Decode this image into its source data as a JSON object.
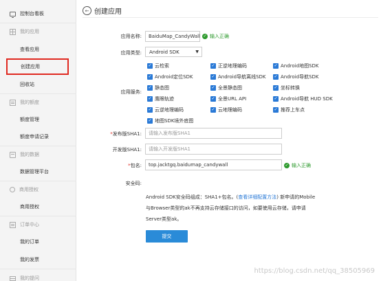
{
  "sidebar": {
    "dashboard": "控制台看板",
    "groups": {
      "apps": "我的应用",
      "quota": "我的额度",
      "data": "我的数据",
      "commercial": "商用授权",
      "orders": "订单中心",
      "tickets": "我的提问"
    },
    "items": {
      "view_apps": "查看应用",
      "create_app": "创建应用",
      "recycle": "回收站",
      "quota_mgmt": "额度管理",
      "quota_apply": "额度申请记录",
      "data_platform": "数据管理平台",
      "commercial_auth": "商用授权",
      "my_orders": "我的订单",
      "my_invoices": "我的发票"
    }
  },
  "header": {
    "back_glyph": "←",
    "title": "创建应用"
  },
  "form": {
    "app_name_label": "应用名称:",
    "app_name_value": "BaiduMap_CandyWall",
    "valid_text": "输入正确",
    "check_glyph": "✓",
    "app_type_label": "应用类型:",
    "app_type_value": "Android SDK",
    "select_arrow": "▼",
    "services_label": "应用服务:",
    "services": [
      [
        "云检索",
        "正逆地理编码",
        "Android地图SDK"
      ],
      [
        "Android定位SDK",
        "Android导航离线SDK",
        "Android导航SDK"
      ],
      [
        "静态图",
        "全景静态图",
        "坐标转换"
      ],
      [
        "鹰眼轨迹",
        "全景URL API",
        "Android导航 HUD SDK"
      ],
      [
        "云逆地理编码",
        "云地理编码",
        "推荐上车点"
      ],
      [
        "地图SDK境外底图"
      ]
    ],
    "release_sha1_label": "发布版SHA1:",
    "release_sha1_placeholder": "请输入发布版SHA1",
    "dev_sha1_label": "开发版SHA1:",
    "dev_sha1_placeholder": "请输入开发版SHA1",
    "package_label": "包名:",
    "package_value": "top.jacktgq.baidumap_candywall",
    "required_mark": "*",
    "security_code_label": "安全码:",
    "desc_line1_pre": "Android SDK安全码组成：SHA1+包名。(",
    "desc_line1_link": "查看详细配置方法",
    "desc_line1_post": ") 新申请的Mobile",
    "desc_line2": "与Browser类型的ak不再支持云存储接口的访问，如要使用云存储，请申请",
    "desc_line3": "Server类型ak。",
    "submit_label": "提交"
  },
  "watermark": "https://blog.csdn.net/qq_38505969",
  "colors": {
    "accent": "#2a8bd8",
    "checkbox": "#2979d6",
    "valid": "#2e9a2e",
    "highlight": "#e0281f"
  }
}
